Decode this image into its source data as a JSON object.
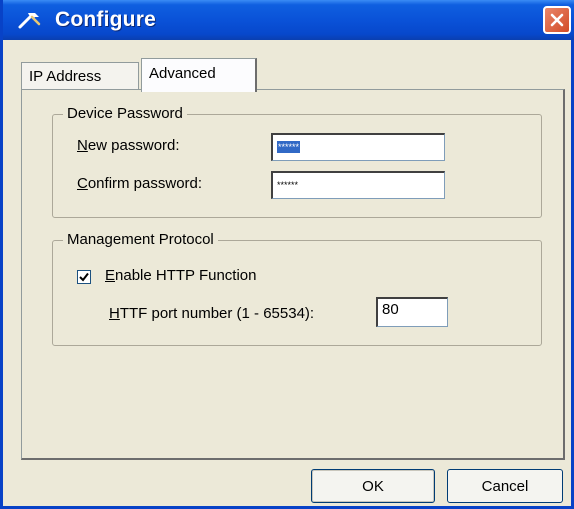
{
  "window": {
    "title": "Configure",
    "title_icon": "wrench-icon",
    "close_icon": "close-icon"
  },
  "tabs": [
    {
      "label": "IP Address",
      "selected": false
    },
    {
      "label": "Advanced",
      "selected": true
    }
  ],
  "device_password": {
    "legend": "Device Password",
    "new_password": {
      "label_first": "N",
      "label_rest": "ew password:",
      "value": "******"
    },
    "confirm_password": {
      "label_first": "C",
      "label_rest": "onfirm password:",
      "value": "******"
    }
  },
  "management_protocol": {
    "legend": "Management Protocol",
    "enable_http": {
      "label_first": "E",
      "label_rest": "nable HTTP Function",
      "checked": true
    },
    "port": {
      "label_first": "H",
      "label_rest": "TTF port number (1 - 65534):",
      "value": "80"
    }
  },
  "buttons": {
    "ok": "OK",
    "cancel": "Cancel"
  },
  "colors": {
    "titlebar": "#0a52d8",
    "face": "#ece9d8",
    "selection": "#3169c6",
    "close": "#d24b26"
  }
}
